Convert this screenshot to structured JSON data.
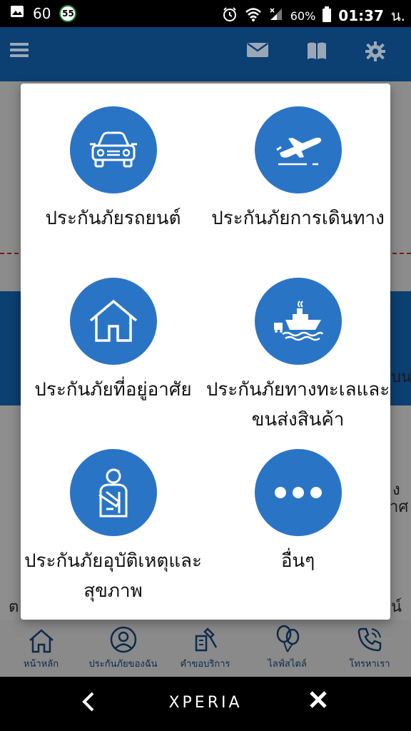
{
  "status_bar": {
    "left_number": "60",
    "badge": "55",
    "battery": "60%",
    "time": "01:37",
    "time_suffix": "น."
  },
  "modal": {
    "options": [
      {
        "label": "ประกันภัยรถยนต์",
        "icon": "car-icon"
      },
      {
        "label": "ประกันภัยการเดินทาง",
        "icon": "airplane-icon"
      },
      {
        "label": "ประกันภัยที่อยู่อาศัย",
        "icon": "house-icon"
      },
      {
        "label": "ประกันภัยทางทะเลและขนส่งสินค้า",
        "icon": "ship-icon"
      },
      {
        "label": "ประกันภัยอุบัติเหตุและสุขภาพ",
        "icon": "injured-person-icon"
      },
      {
        "label": "อื่นๆ",
        "icon": "more-dots-icon"
      }
    ]
  },
  "bottom_nav": [
    {
      "label": "หน้าหลัก",
      "icon": "home-icon"
    },
    {
      "label": "ประกันภัยของฉัน",
      "icon": "user-circle-icon"
    },
    {
      "label": "คำขอบริการ",
      "icon": "service-request-icon"
    },
    {
      "label": "ไลฟ์สไตล์",
      "icon": "balloons-icon"
    },
    {
      "label": "โทรหาเรา",
      "icon": "phone-icon"
    }
  ],
  "system_nav": {
    "brand": "XPERIA"
  },
  "background_fragments": {
    "right_1": "บน",
    "right_2": "ง",
    "right_3": "าศ",
    "right_4": "น์",
    "left_1": "ต"
  },
  "colors": {
    "accent": "#2a74c6",
    "header": "#0c3f72"
  }
}
